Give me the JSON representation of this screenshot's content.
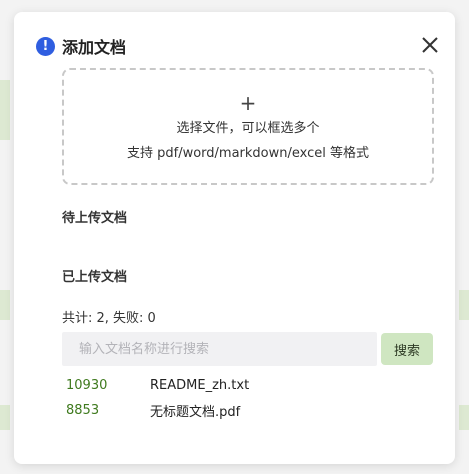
{
  "dialog": {
    "title": "添加文档",
    "warn_icon": "!",
    "close_icon": "close-icon"
  },
  "dropzone": {
    "plus": "+",
    "line1": "选择文件，可以框选多个",
    "line2": "支持 pdf/word/markdown/excel 等格式"
  },
  "sections": {
    "pending_title": "待上传文档",
    "uploaded_title": "已上传文档"
  },
  "stats": {
    "text": "共计: 2, 失败: 0"
  },
  "search": {
    "placeholder": "输入文档名称进行搜索",
    "button_label": "搜索"
  },
  "files": [
    {
      "id": "10930",
      "name": "README_zh.txt"
    },
    {
      "id": "8853",
      "name": "无标题文档.pdf"
    }
  ],
  "colors": {
    "accent_green": "#cfe6c1",
    "link_green": "#3f7a1e",
    "warn_blue": "#2f5ee0"
  }
}
